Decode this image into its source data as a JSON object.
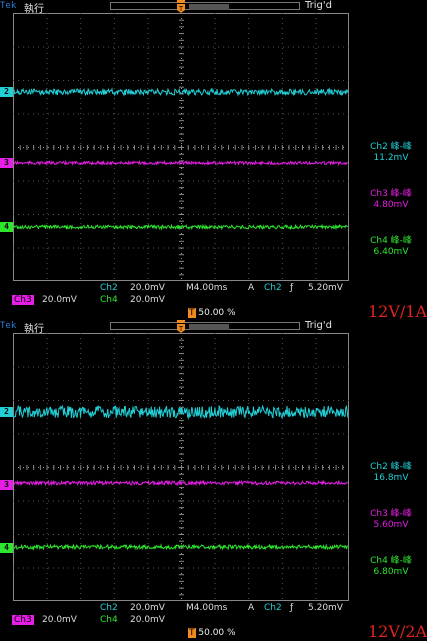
{
  "panels": [
    {
      "label": "12V/1A",
      "header": {
        "brand": "Tek",
        "state": "執行",
        "trig": "Trig'd"
      },
      "channels": [
        {
          "id": "2",
          "color": "#22cfd6",
          "name": "Ch2 峰-峰",
          "value": "11.2mV"
        },
        {
          "id": "3",
          "color": "#e61ee6",
          "name": "Ch3 峰-峰",
          "value": "4.80mV"
        },
        {
          "id": "4",
          "color": "#2ee62e",
          "name": "Ch4 峰-峰",
          "value": "6.40mV"
        }
      ],
      "bottom": {
        "ch2": "Ch2",
        "ch2_scale": "20.0mV",
        "time": "M4.00ms",
        "mode": "A",
        "trig_src": "Ch2",
        "trig_level": "5.20mV",
        "ch3": "Ch3",
        "ch3_scale": "20.0mV",
        "ch4": "Ch4",
        "ch4_scale": "20.0mV",
        "trig_pos": "50.00 %"
      }
    },
    {
      "label": "12V/2A",
      "header": {
        "brand": "Tek",
        "state": "執行",
        "trig": "Trig'd"
      },
      "channels": [
        {
          "id": "2",
          "color": "#22cfd6",
          "name": "Ch2 峰-峰",
          "value": "16.8mV"
        },
        {
          "id": "3",
          "color": "#e61ee6",
          "name": "Ch3 峰-峰",
          "value": "5.60mV"
        },
        {
          "id": "4",
          "color": "#2ee62e",
          "name": "Ch4 峰-峰",
          "value": "6.80mV"
        }
      ],
      "bottom": {
        "ch2": "Ch2",
        "ch2_scale": "20.0mV",
        "time": "M4.00ms",
        "mode": "A",
        "trig_src": "Ch2",
        "trig_level": "5.20mV",
        "ch3": "Ch3",
        "ch3_scale": "20.0mV",
        "ch4": "Ch4",
        "ch4_scale": "20.0mV",
        "trig_pos": "50.00 %"
      }
    }
  ]
}
